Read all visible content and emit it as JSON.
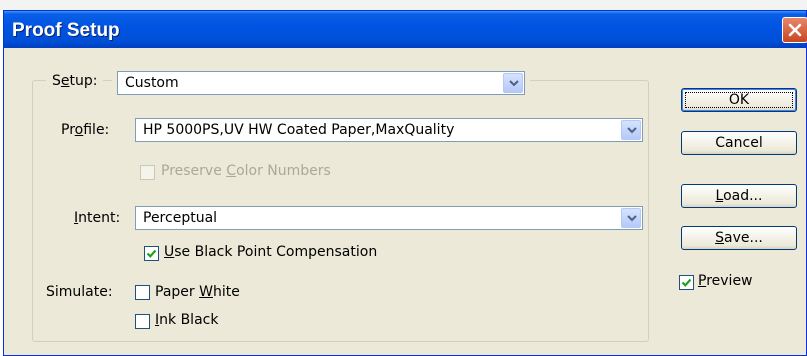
{
  "window": {
    "title": "Proof Setup"
  },
  "setup": {
    "label": "Setup:",
    "label_pre": "S",
    "label_u": "e",
    "label_post": "tup:",
    "value": "Custom"
  },
  "profile": {
    "label_pre": "Pr",
    "label_u": "o",
    "label_post": "file:",
    "value": "HP 5000PS,UV HW Coated Paper,MaxQuality"
  },
  "preserve": {
    "label_pre": "Preserve ",
    "label_u": "C",
    "label_post": "olor Numbers",
    "checked": false,
    "enabled": false
  },
  "intent": {
    "label_pre": "",
    "label_u": "I",
    "label_post": "ntent:",
    "value": "Perceptual"
  },
  "black_point": {
    "label_pre": "",
    "label_u": "U",
    "label_post": "se Black Point Compensation",
    "checked": true
  },
  "simulate": {
    "label": "Simulate:",
    "paper_white": {
      "label_pre": "Paper ",
      "label_u": "W",
      "label_post": "hite",
      "checked": false
    },
    "ink_black": {
      "label_pre": "",
      "label_u": "I",
      "label_post": "nk Black",
      "checked": false
    }
  },
  "buttons": {
    "ok": {
      "label": "OK"
    },
    "cancel": {
      "label": "Cancel"
    },
    "load": {
      "label_pre": "",
      "label_u": "L",
      "label_post": "oad..."
    },
    "save": {
      "label_pre": "",
      "label_u": "S",
      "label_post": "ave..."
    }
  },
  "preview": {
    "label_pre": "",
    "label_u": "P",
    "label_post": "review",
    "checked": true
  },
  "colors": {
    "titlebar": "#0054e3",
    "dialog_bg": "#ece9d8",
    "check": "#21a121",
    "close": "#c8461f"
  },
  "icons": {
    "close": "close-icon",
    "dropdown": "chevron-down-icon",
    "check": "checkmark-icon"
  }
}
